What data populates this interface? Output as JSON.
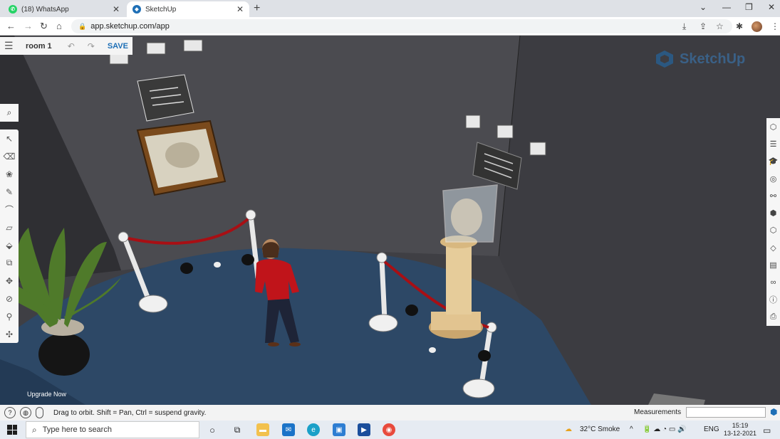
{
  "browser": {
    "tabs": [
      {
        "label": "(18) WhatsApp",
        "icon": "whatsapp-icon"
      },
      {
        "label": "SketchUp",
        "icon": "sketchup-icon"
      }
    ],
    "url": "app.sketchup.com/app"
  },
  "sketchup": {
    "model_name": "room 1",
    "save_label": "SAVE",
    "logo_text": "SketchUp",
    "upgrade_label": "Upgrade Now",
    "status_hint": "Drag to orbit. Shift = Pan, Ctrl = suspend gravity.",
    "measurements_label": "Measurements",
    "left_tools": [
      "select-icon",
      "eraser-icon",
      "paint-bucket-icon",
      "pencil-icon",
      "arc-icon",
      "rectangle-icon",
      "push-pull-icon",
      "offset-icon",
      "move-icon",
      "rotate-icon",
      "tape-measure-icon",
      "orbit-icon"
    ],
    "right_tools": [
      "entity-info-icon",
      "layers-icon",
      "instructor-icon",
      "materials-icon",
      "components-icon",
      "outliner-icon",
      "solid-tools-icon",
      "tags-icon",
      "scenes-icon",
      "display-icon",
      "info-icon",
      "export-icon"
    ]
  },
  "taskbar": {
    "search_placeholder": "Type here to search",
    "weather": "32°C  Smoke",
    "language": "ENG",
    "time": "15:19",
    "date": "13-12-2021"
  },
  "colors": {
    "sketchup_blue": "#1e6fb6",
    "floor": "#2d4866",
    "wall": "#48484d"
  }
}
